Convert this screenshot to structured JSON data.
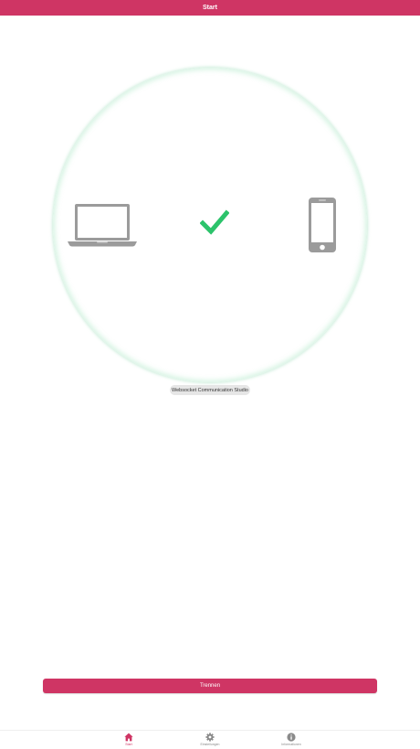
{
  "header": {
    "title": "Start"
  },
  "status": {
    "device_name": "Websocket Communication Studio",
    "connected": true
  },
  "actions": {
    "disconnect_label": "Trennen"
  },
  "tabs": [
    {
      "label": "Start",
      "icon": "home-icon",
      "active": true
    },
    {
      "label": "Einstellungen",
      "icon": "gear-icon",
      "active": false
    },
    {
      "label": "Informationen",
      "icon": "info-icon",
      "active": false
    }
  ],
  "colors": {
    "primary": "#cf3564",
    "check": "#2cc36b",
    "device_gray": "#9b9b9b",
    "inactive_tab": "#8a8a8a"
  }
}
